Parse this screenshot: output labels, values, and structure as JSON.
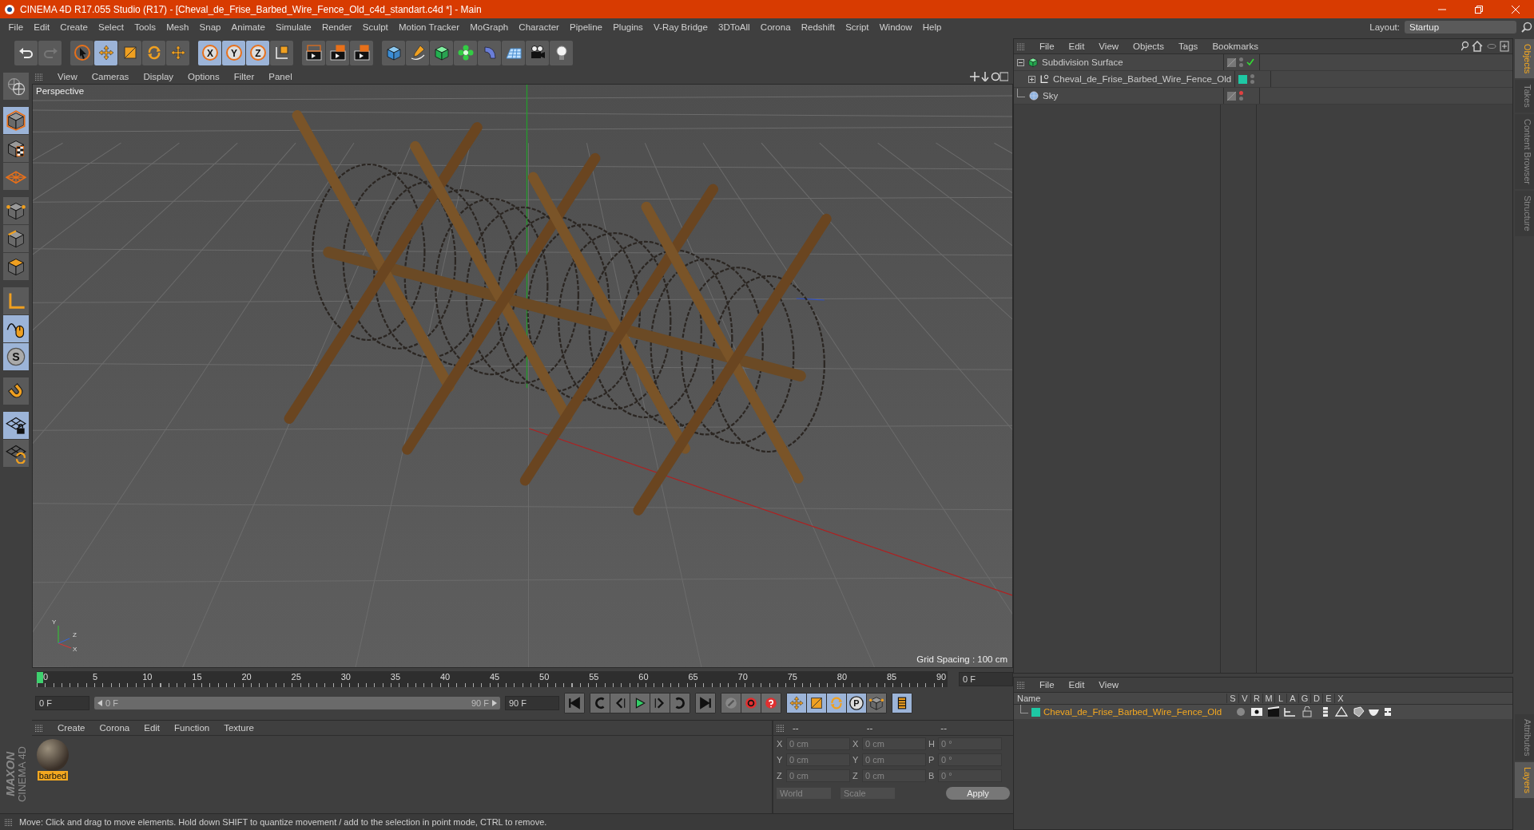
{
  "window": {
    "title": "CINEMA 4D R17.055 Studio (R17) - [Cheval_de_Frise_Barbed_Wire_Fence_Old_c4d_standart.c4d *] - Main"
  },
  "menu": [
    "File",
    "Edit",
    "Create",
    "Select",
    "Tools",
    "Mesh",
    "Snap",
    "Animate",
    "Simulate",
    "Render",
    "Sculpt",
    "Motion Tracker",
    "MoGraph",
    "Character",
    "Pipeline",
    "Plugins",
    "V-Ray Bridge",
    "3DToAll",
    "Corona",
    "Redshift",
    "Script",
    "Window",
    "Help"
  ],
  "layout": {
    "label": "Layout:",
    "value": "Startup"
  },
  "toolbar": [
    {
      "kind": "undo",
      "on": false
    },
    {
      "kind": "redo",
      "on": false
    },
    {
      "kind": "select",
      "on": false
    },
    {
      "kind": "move",
      "on": true
    },
    {
      "kind": "scale",
      "on": false
    },
    {
      "kind": "rotate",
      "on": false
    },
    {
      "kind": "last",
      "on": false
    },
    {
      "kind": "axis",
      "label": "X",
      "on": true
    },
    {
      "kind": "axis",
      "label": "Y",
      "on": true
    },
    {
      "kind": "axis",
      "label": "Z",
      "on": true
    },
    {
      "kind": "coord",
      "on": false
    },
    {
      "kind": "render-view",
      "on": false
    },
    {
      "kind": "render",
      "on": false
    },
    {
      "kind": "render-settings",
      "on": false
    },
    {
      "kind": "cube",
      "on": false
    },
    {
      "kind": "pen",
      "on": false
    },
    {
      "kind": "subdivision",
      "on": false
    },
    {
      "kind": "cloner",
      "on": false
    },
    {
      "kind": "deformer",
      "on": false
    },
    {
      "kind": "floor",
      "on": false
    },
    {
      "kind": "camera",
      "on": false
    },
    {
      "kind": "light",
      "on": false
    }
  ],
  "left_toolbar": [
    {
      "kind": "make-editable",
      "on": false
    },
    {
      "kind": "model",
      "on": true
    },
    {
      "kind": "texture",
      "on": false
    },
    {
      "kind": "workplane",
      "on": false
    },
    {
      "kind": "points",
      "on": false
    },
    {
      "kind": "edges",
      "on": false
    },
    {
      "kind": "polygons",
      "on": false
    },
    {
      "kind": "axis-mode",
      "on": false
    },
    {
      "kind": "tweak",
      "on": true
    },
    {
      "kind": "sculpt",
      "label": "S",
      "on": true
    },
    {
      "kind": "magnet",
      "on": false
    },
    {
      "kind": "lock-grid",
      "on": true
    },
    {
      "kind": "grid-sync",
      "on": false
    }
  ],
  "viewport": {
    "menu": [
      "View",
      "Cameras",
      "Display",
      "Options",
      "Filter",
      "Panel"
    ],
    "camera": "Perspective",
    "grid_spacing": "Grid Spacing : 100 cm",
    "gizmo_labels": [
      "Y",
      "Z",
      "X"
    ]
  },
  "timeline": {
    "ticks": [
      "0",
      "5",
      "10",
      "15",
      "20",
      "25",
      "30",
      "35",
      "40",
      "45",
      "50",
      "55",
      "60",
      "65",
      "70",
      "75",
      "80",
      "85",
      "90"
    ],
    "level": 0,
    "frame_field": "0 F",
    "start_field": "0 F",
    "range": {
      "start": "0 F",
      "end": "90 F",
      "level": 1
    },
    "end_field": "90 F",
    "key_modes": [
      {
        "kind": "move",
        "on": true
      },
      {
        "kind": "scale",
        "on": true
      },
      {
        "kind": "rotate",
        "on": true
      },
      {
        "kind": "param",
        "label": "P",
        "on": true
      },
      {
        "kind": "points",
        "on": false
      }
    ]
  },
  "material_manager": {
    "menu": [
      "Create",
      "Corona",
      "Edit",
      "Function",
      "Texture"
    ],
    "materials": [
      {
        "name": "barbed",
        "selected": true
      }
    ],
    "brand": [
      "MAXON",
      "CINEMA 4D"
    ]
  },
  "coordinates": {
    "headers": [
      "--",
      "--",
      "--"
    ],
    "rows": [
      {
        "axis": "X",
        "position": "0 cm",
        "size_axis": "X",
        "size": "0 cm",
        "rot_axis": "H",
        "rotation": "0 °"
      },
      {
        "axis": "Y",
        "position": "0 cm",
        "size_axis": "Y",
        "size": "0 cm",
        "rot_axis": "P",
        "rotation": "0 °"
      },
      {
        "axis": "Z",
        "position": "0 cm",
        "size_axis": "Z",
        "size": "0 cm",
        "rot_axis": "B",
        "rotation": "0 °"
      }
    ],
    "mode": "World",
    "transform": "Scale",
    "apply": "Apply"
  },
  "status_bar": "Move: Click and drag to move elements. Hold down SHIFT to quantize movement / add to the selection in point mode, CTRL to remove.",
  "object_manager": {
    "menu": [
      "File",
      "Edit",
      "View",
      "Objects",
      "Tags",
      "Bookmarks"
    ],
    "objects": [
      {
        "kind": "subdivision",
        "name": "Subdivision Surface",
        "expanded": true,
        "checked": true,
        "editor_hidden": false,
        "children": [
          {
            "kind": "null",
            "name": "Cheval_de_Frise_Barbed_Wire_Fence_Old",
            "expanded": false,
            "color": "#1ec8a4",
            "editor_hidden": false
          }
        ]
      },
      {
        "kind": "sky",
        "name": "Sky",
        "editor_hidden": true
      }
    ]
  },
  "layers": {
    "menu": [
      "File",
      "Edit",
      "View"
    ],
    "columns": [
      "Name",
      "S",
      "V",
      "R",
      "M",
      "L",
      "A",
      "G",
      "D",
      "E",
      "X"
    ],
    "items": [
      {
        "name": "Cheval_de_Frise_Barbed_Wire_Fence_Old",
        "color": "#1ec8a4"
      }
    ]
  },
  "side_tabs": {
    "top": [
      {
        "label": "Objects",
        "selected": true
      },
      {
        "label": "Takes",
        "selected": false
      },
      {
        "label": "Content Browser",
        "selected": false
      },
      {
        "label": "Structure",
        "selected": false
      }
    ],
    "bottom": [
      {
        "label": "Attributes",
        "selected": false
      },
      {
        "label": "Layers",
        "selected": true
      }
    ]
  }
}
